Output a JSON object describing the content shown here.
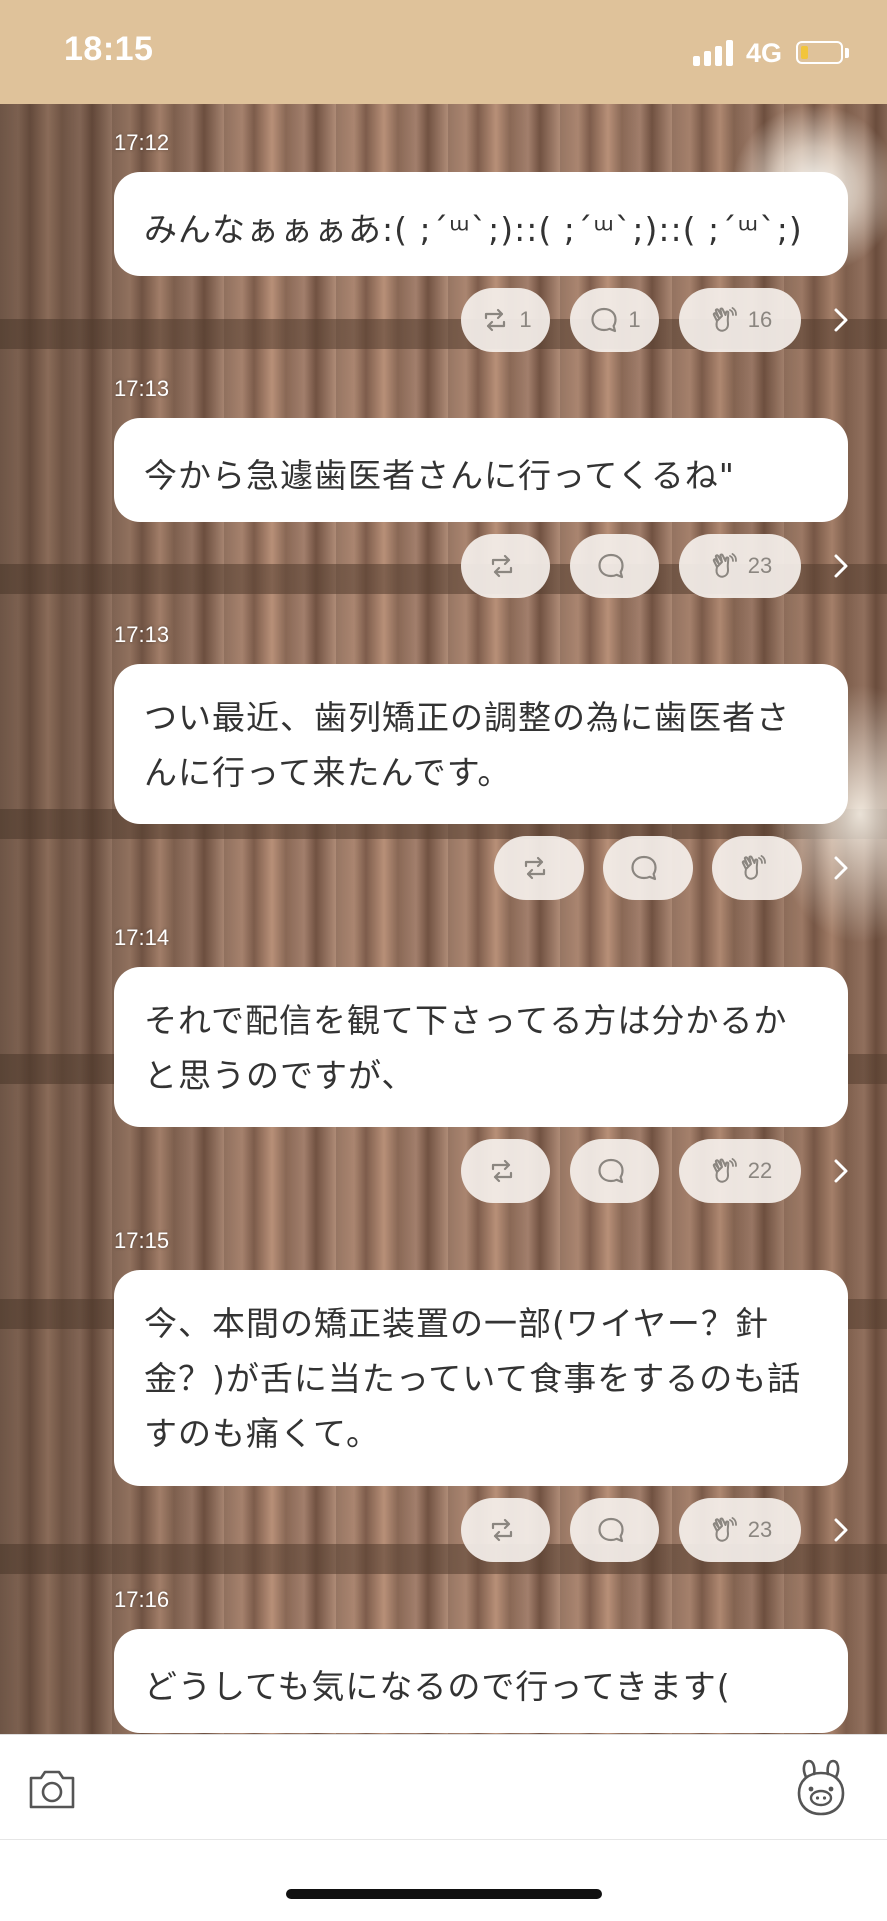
{
  "status_bar": {
    "time": "18:15",
    "network": "4G",
    "battery_level": 0.2,
    "battery_color": "#f2c53b"
  },
  "posts": [
    {
      "time": "17:12",
      "text": "みんなぁぁぁあ:( ;´ᵚ`;)::( ;´ᵚ`;)::( ;´ᵚ`;)",
      "repost_count": "1",
      "comment_count": "1",
      "clap_count": "16"
    },
    {
      "time": "17:13",
      "text": "今から急遽歯医者さんに行ってくるね\"",
      "repost_count": "",
      "comment_count": "",
      "clap_count": "23"
    },
    {
      "time": "17:13",
      "text": "つい最近、歯列矯正の調整の為に歯医者さんに行って来たんです。",
      "repost_count": "",
      "comment_count": "",
      "clap_count": ""
    },
    {
      "time": "17:14",
      "text": "それで配信を観て下さってる方は分かるかと思うのですが、",
      "repost_count": "",
      "comment_count": "",
      "clap_count": "22"
    },
    {
      "time": "17:15",
      "text": "今、本間の矯正装置の一部(ワイヤー？針金？)が舌に当たっていて食事をするのも話すのも痛くて。",
      "repost_count": "",
      "comment_count": "",
      "clap_count": "23"
    },
    {
      "time": "17:16",
      "text": "どうしても気になるので行ってきます(",
      "repost_count": "",
      "comment_count": "",
      "clap_count": ""
    }
  ],
  "icons": {
    "repost": "repost-icon",
    "comment": "comment-icon",
    "clap": "clap-icon",
    "more": "chevron-right-icon",
    "camera": "camera-icon",
    "mascot": "mascot-icon"
  }
}
